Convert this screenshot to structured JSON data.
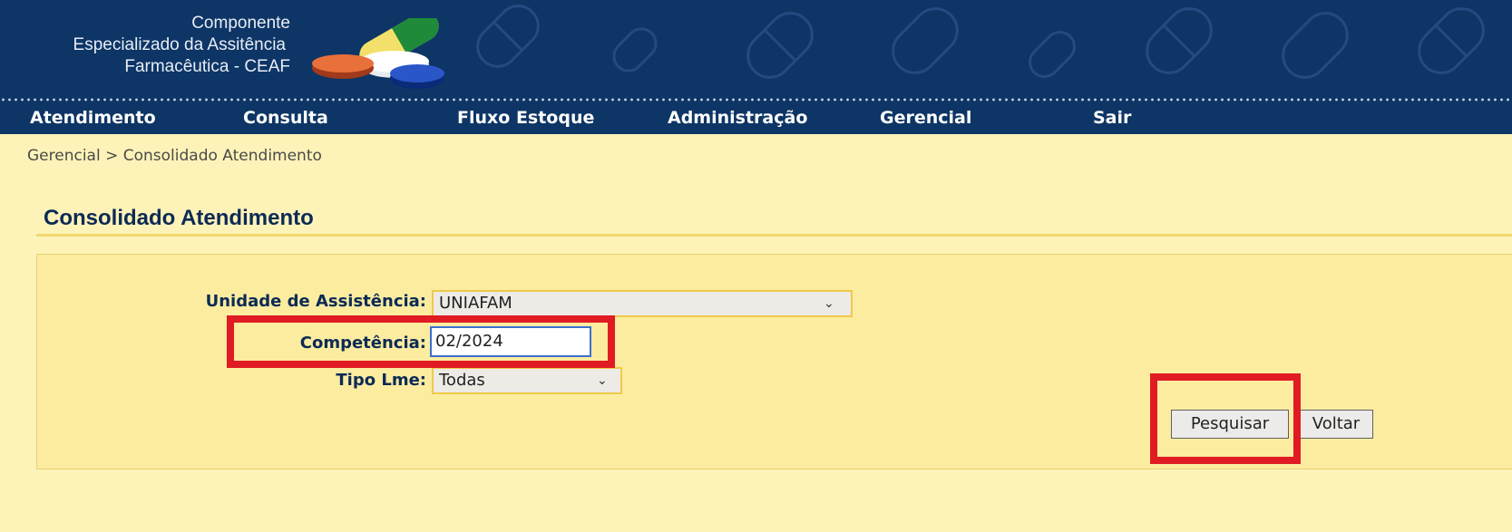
{
  "header": {
    "logo_line1": "Componente",
    "logo_line2": "Especializado da Assitência",
    "logo_line3": "Farmacêutica - CEAF"
  },
  "nav": {
    "items": [
      "Atendimento",
      "Consulta",
      "Fluxo Estoque",
      "Administração",
      "Gerencial",
      "Sair"
    ]
  },
  "breadcrumb": "Gerencial > Consolidado Atendimento",
  "page_title": "Consolidado Atendimento",
  "form": {
    "unidade_label": "Unidade de Assistência:",
    "unidade_value": "UNIAFAM",
    "competencia_label": "Competência:",
    "competencia_value": "02/2024",
    "tipo_label": "Tipo Lme:",
    "tipo_value": "Todas"
  },
  "buttons": {
    "pesquisar": "Pesquisar",
    "voltar": "Voltar"
  },
  "colors": {
    "header_bg": "#0d3566",
    "page_bg": "#fdf3b8",
    "highlight": "#e01b24"
  }
}
